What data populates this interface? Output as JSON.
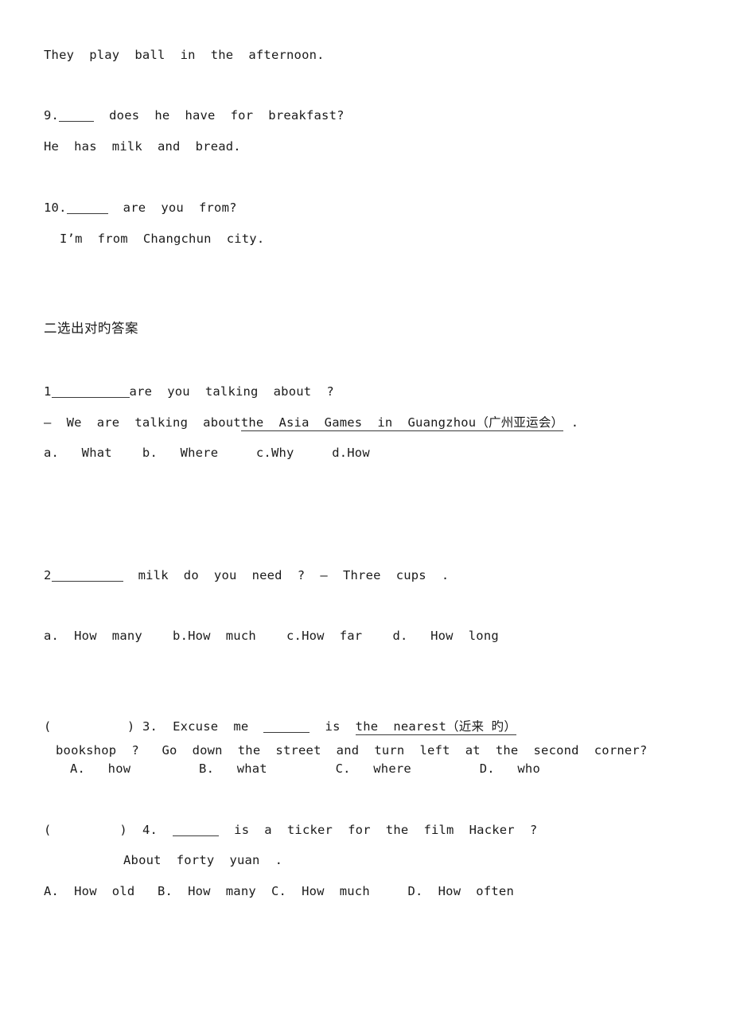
{
  "document": {
    "type": "worksheet",
    "language": "en-zh",
    "page_background": "#ffffff",
    "text_color": "#1b1b1b"
  },
  "section_one_tail": {
    "q8_answer": "They  play  ball  in  the  afternoon.",
    "q9_number": "9.",
    "q9_rest": "  does  he  have  for  breakfast?",
    "q9_answer": "He  has  milk  and  bread.",
    "q10_number": "10.",
    "q10_rest": "  are  you  from?",
    "q10_answer": "I’m  from  Changchun  city."
  },
  "section_two": {
    "heading": "二选出对旳答案",
    "questions": [
      {
        "number": "1",
        "stem_after_blank": "are  you  talking  about  ?",
        "answer_prefix": "–  We  are  talking  about",
        "answer_underlined": "the  Asia  Games  in  Guangzhou（广州亚运会）",
        "answer_suffix": " .",
        "options_line": "a.   What    b.   Where     c.Why     d.How"
      },
      {
        "number": "2",
        "stem_after_blank": "  milk  do  you  need  ?  –  Three  cups  .",
        "options_line": "a.  How  many    b.How  much    c.How  far    d.   How  long"
      },
      {
        "number": "3",
        "bracket": "(          )",
        "label": "3.",
        "stem_before_blank": "  Excuse  me  ",
        "stem_mid": "  is  ",
        "stem_underlined": "the  nearest（近来 旳）",
        "continuation": "bookshop  ?   Go  down  the  street  and  turn  left  at  the  second  corner?",
        "options_line": "A.   how         B.   what         C.   where         D.   who"
      },
      {
        "number": "4",
        "bracket": "(         )",
        "label": "4.",
        "stem_after_blank": "  is  a  ticker  for  the  film  Hacker  ?",
        "answer_line": "About  forty  yuan  .",
        "options_line": "A.  How  old   B.  How  many  C.  How  much     D.  How  often"
      }
    ]
  }
}
